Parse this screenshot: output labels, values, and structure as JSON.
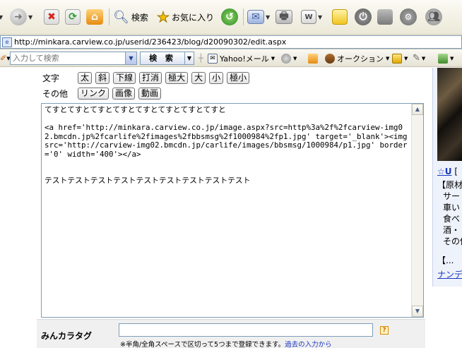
{
  "toolbar": {
    "search_label": "検索",
    "favorites_label": "お気に入り"
  },
  "address": {
    "url": "http://minkara.carview.co.jp/userid/236423/blog/d20090302/edit.aspx"
  },
  "yahoo_bar": {
    "search_placeholder": "入力して検索",
    "search_button": "検 索",
    "mail_label": "Yahoo!メール",
    "auction_label": "オークション"
  },
  "format": {
    "row1_label": "文字",
    "row1_buttons": [
      "太",
      "斜",
      "下線",
      "打消",
      "極大",
      "大",
      "小",
      "極小"
    ],
    "row2_label": "その他",
    "row2_buttons": [
      "リンク",
      "画像",
      "動画"
    ]
  },
  "editor": {
    "content": "てすとてすとてすとてすとてすとてすとてすとてすと\n\n<a href='http://minkara.carview.co.jp/image.aspx?src=http%3a%2f%2fcarview-img02.bmcdn.jp%2fcarlife%2fimages%2fbbsmsg%2f1000984%2fp1.jpg' target='_blank'><img src='http://carview-img02.bmcdn.jp/carlife/images/bbsmsg/1000984/p1.jpg' border='0' width='400'></a>\n\n\nテストテストテストテストテストテストテストテストテスト"
  },
  "tags": {
    "label": "みんカラタグ",
    "help": "?",
    "note": "※半角/全角スペースで区切って5つまで登録できます。",
    "history_link": "過去の入力から"
  },
  "sidebar": {
    "line1_link": "☆U",
    "line1_rest": "[",
    "line2": "【原材料",
    "line3": "サー",
    "line4": "車い",
    "line5": "食べ",
    "line6": "酒・・",
    "line7": "その他",
    "line8": "【...",
    "line9_link": "ナンデ"
  }
}
